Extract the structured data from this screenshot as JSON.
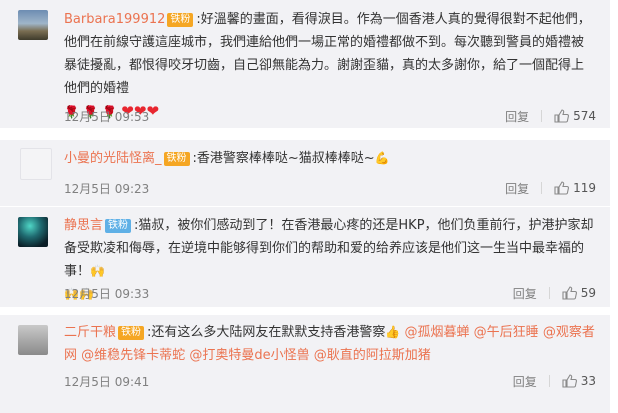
{
  "comments": [
    {
      "user": "Barbara199912",
      "badge": "铁粉",
      "text_parts": [
        ":好溫馨的畫面，看得淚目。作為一個香港人真的覺得很對不起他們，他們在前線守護這座城市，我們連給他們一場正常的婚禮都做不到。每次聽到警員的婚禮被暴徒擾亂，都恨得咬牙切齒，自己卻無能為力。謝謝歪貓，真的太多謝你，給了一個配得上他們的婚禮"
      ],
      "emojis": [
        "rose",
        "rose",
        "rose",
        "heart",
        "heart",
        "heart"
      ],
      "time": "12月5日 09:53",
      "reply_label": "回复",
      "likes": "574"
    },
    {
      "user": "小曼的光陆怪离_",
      "badge": "铁粉",
      "text": ":香港警察棒棒哒~猫叔棒棒哒~",
      "time": "12月5日 09:23",
      "reply_label": "回复",
      "likes": "119"
    },
    {
      "user": "静思言",
      "badge": "铁粉",
      "text": ":猫叔，被你们感动到了！在香港最心疼的还是HKP，他们负重前行，护港护家却备受欺凌和侮辱，在逆境中能够得到你们的帮助和爱的给养应该是他们这一生当中最幸福的事！",
      "time": "12月5日 09:33",
      "reply_label": "回复",
      "likes": "59"
    },
    {
      "user": "二斤干粮",
      "badge": "铁粉",
      "text": ":还有这么多大陆网友在默默支持香港警察",
      "mentions": [
        "@孤烟暮蝉",
        "@午后狂睡",
        "@观察者网",
        "@维稳先锋卡蒂蛇",
        "@打奥特曼de小怪兽",
        "@耿直的阿拉斯加猪"
      ],
      "time": "12月5日 09:41",
      "reply_label": "回复",
      "likes": "33"
    }
  ],
  "icons": {
    "like": "thumbs-up-icon",
    "muscle": "flexed-biceps-emoji",
    "cheer": "hands-emoji",
    "rose": "rose-emoji",
    "heart": "heart-emoji"
  },
  "colors": {
    "username": "#eb7350",
    "card_bg": "#f2f2f5",
    "badge_gold": "#f5a623",
    "badge_blue": "#5fb0e6"
  }
}
